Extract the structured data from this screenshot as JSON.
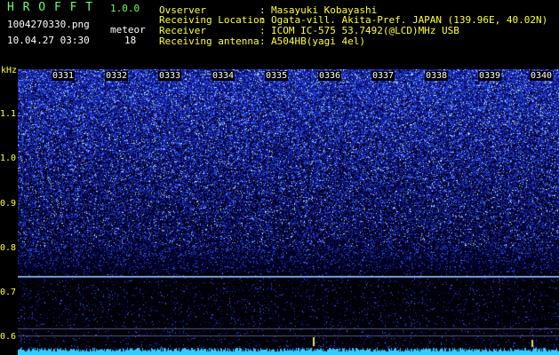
{
  "app": {
    "title": "H R O F F T",
    "version": "1.0.0",
    "filename": "1004270330.png",
    "timestamp": "10.04.27 03:30",
    "meteor_label": "meteor",
    "meteor_count": "18"
  },
  "info": {
    "rows": [
      {
        "label": "Ovserver",
        "sep": ":",
        "value": "Masayuki Kobayashi"
      },
      {
        "label": "Receiving Location",
        "sep": ":",
        "value": "Ogata-vill. Akita-Pref. JAPAN (139.96E, 40.02N)"
      },
      {
        "label": "Receiver",
        "sep": ":",
        "value": "ICOM IC-575 53.7492(@LCD)MHz USB"
      },
      {
        "label": "Receiving antenna",
        "sep": ":",
        "value": "A504HB(yagi 4el)"
      }
    ]
  },
  "spectrogram": {
    "y_unit": "kHz",
    "y_ticks": [
      "1.1",
      "1.0",
      "0.9",
      "0.8",
      "0.7",
      "0.6"
    ],
    "x_ticks": [
      "0331",
      "0332",
      "0333",
      "0334",
      "0335",
      "0336",
      "0337",
      "0338",
      "0339",
      "0340"
    ],
    "colors": {
      "signal": "#3a5cff",
      "low": "#0a0a60",
      "line": "#e6e64d",
      "bottom": "#33ccff"
    }
  }
}
